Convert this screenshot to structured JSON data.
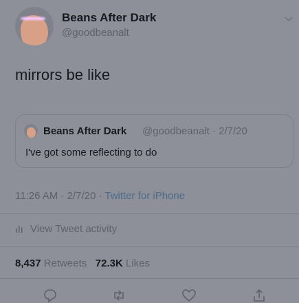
{
  "author": {
    "name": "Beans After Dark",
    "handle": "@goodbeanalt"
  },
  "tweet": {
    "text": "mirrors be like"
  },
  "quoted_tweet": {
    "name": "Beans After Dark",
    "meta": "@goodbeanalt · 2/7/20",
    "text": "I've got some reflecting to do"
  },
  "timestamp": {
    "time_date": "11:26 AM · 2/7/20 · ",
    "source": "Twitter for iPhone"
  },
  "activity": {
    "label": "View Tweet activity"
  },
  "stats": {
    "retweets_count": "8,437",
    "retweets_label": "Retweets",
    "likes_count": "72.3K",
    "likes_label": "Likes"
  },
  "actions": {
    "icons": [
      "reply-icon",
      "retweet-icon",
      "like-icon",
      "share-icon"
    ]
  }
}
